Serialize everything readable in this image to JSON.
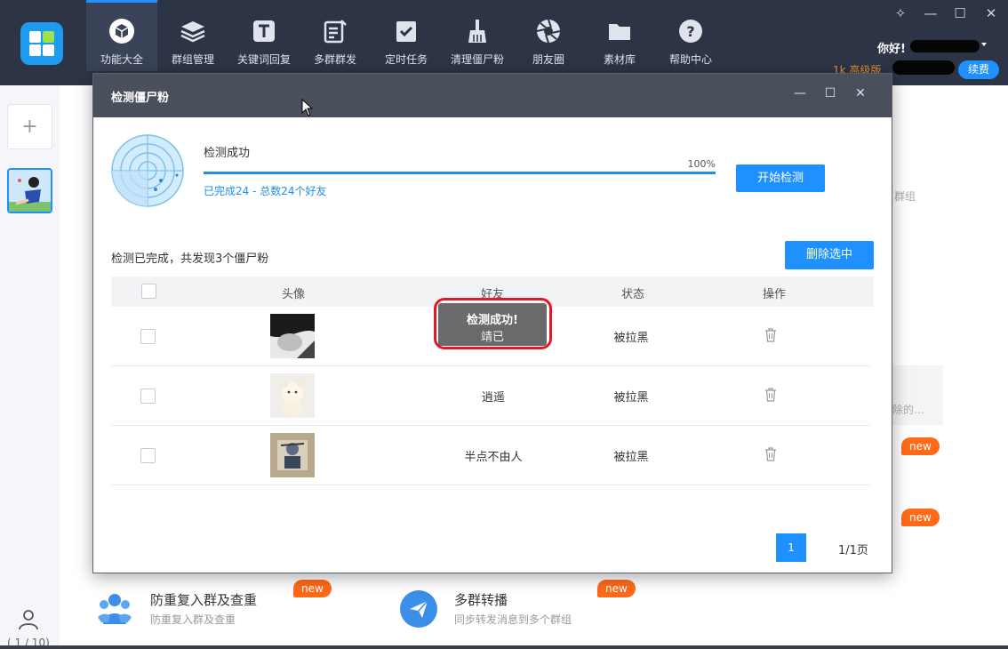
{
  "nav": {
    "items": [
      {
        "label": "功能大全",
        "icon": "cube-icon",
        "active": true
      },
      {
        "label": "群组管理",
        "icon": "layers-icon"
      },
      {
        "label": "关键词回复",
        "icon": "text-t-icon"
      },
      {
        "label": "多群群发",
        "icon": "broadcast-edit-icon"
      },
      {
        "label": "定时任务",
        "icon": "clipboard-check-icon"
      },
      {
        "label": "清理僵尸粉",
        "icon": "broom-icon"
      },
      {
        "label": "朋友圈",
        "icon": "aperture-icon"
      },
      {
        "label": "素材库",
        "icon": "folder-icon"
      },
      {
        "label": "帮助中心",
        "icon": "help-icon"
      }
    ]
  },
  "header": {
    "greeting": "你好!",
    "vip_label": "1k 高级版",
    "renew_label": "续费",
    "window_controls": {
      "pin": "✧",
      "minimize": "—",
      "maximize": "☐",
      "close": "✕"
    }
  },
  "sidebar": {
    "add_label": "+",
    "pager": "( 1 / 10)"
  },
  "background": {
    "group_text": "群组",
    "card_text": "除的...",
    "new_badge": "new",
    "features": [
      {
        "title": "防重复入群及查重",
        "desc": "防重复入群及查重",
        "icon": "users-icon"
      },
      {
        "title": "多群转播",
        "desc": "同步转发消息到多个群组",
        "icon": "send-icon"
      }
    ]
  },
  "dialog": {
    "title": "检测僵尸粉",
    "controls": {
      "minimize": "—",
      "maximize": "☐",
      "close": "✕"
    },
    "status_title": "检测成功",
    "progress_label": "100%",
    "progress_value": 1.0,
    "done_text": "已完成24 - 总数24个好友",
    "start_button": "开始检测",
    "summary": "检测已完成，共发现3个僵尸粉",
    "delete_button": "删除选中",
    "table": {
      "headers": [
        "头像",
        "好友",
        "状态",
        "操作"
      ],
      "rows": [
        {
          "name": "靖已",
          "status": "被拉黑"
        },
        {
          "name": "逍遥",
          "status": "被拉黑"
        },
        {
          "name": "半点不由人",
          "status": "被拉黑"
        }
      ]
    },
    "pagination": {
      "current": "1",
      "total": "1/1页"
    },
    "toast": "检测成功!"
  },
  "colors": {
    "accent": "#1e90ff",
    "topbar": "#2c3446",
    "dialog_title": "#4a4f5c",
    "new_badge": "#ff6a1a",
    "highlight": "#e0192b"
  }
}
